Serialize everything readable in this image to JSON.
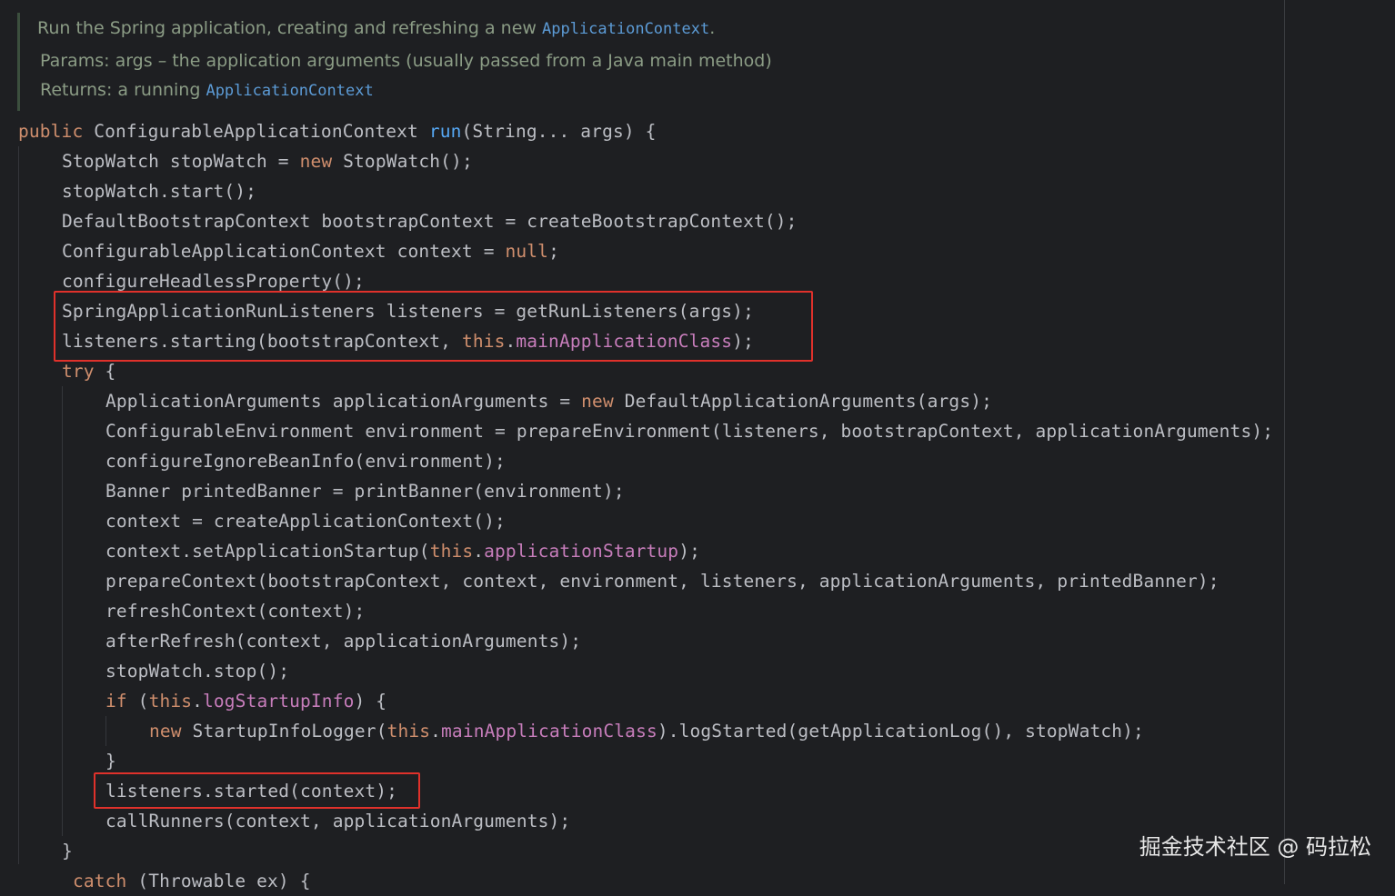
{
  "doc": {
    "summary_text": "Run the Spring application, creating and refreshing a new ",
    "summary_code": "ApplicationContext",
    "summary_end": ".",
    "params_label": "Params:",
    "params_name": "args",
    "params_desc": " – the application arguments (usually passed from a Java main method)",
    "returns_label": "Returns:",
    "returns_text": "a running ",
    "returns_code": "ApplicationContext"
  },
  "code": [
    [
      [
        "kw",
        "public"
      ],
      [
        "t",
        " ConfigurableApplicationContext "
      ],
      [
        "fn",
        "run"
      ],
      [
        "t",
        "(String... args) {"
      ]
    ],
    [
      [
        "t",
        "StopWatch stopWatch = "
      ],
      [
        "kw",
        "new"
      ],
      [
        "t",
        " StopWatch();"
      ]
    ],
    [
      [
        "t",
        "stopWatch.start();"
      ]
    ],
    [
      [
        "t",
        "DefaultBootstrapContext bootstrapContext = createBootstrapContext();"
      ]
    ],
    [
      [
        "t",
        "ConfigurableApplicationContext context = "
      ],
      [
        "kw",
        "null"
      ],
      [
        "t",
        ";"
      ]
    ],
    [
      [
        "t",
        "configureHeadlessProperty();"
      ]
    ],
    [
      [
        "t",
        "SpringApplicationRunListeners listeners = getRunListeners(args);"
      ]
    ],
    [
      [
        "t",
        "listeners.starting(bootstrapContext, "
      ],
      [
        "kw",
        "this"
      ],
      [
        "t",
        "."
      ],
      [
        "fld",
        "mainApplicationClass"
      ],
      [
        "t",
        ");"
      ]
    ],
    [
      [
        "kw",
        "try"
      ],
      [
        "t",
        " {"
      ]
    ],
    [
      [
        "t",
        "ApplicationArguments applicationArguments = "
      ],
      [
        "kw",
        "new"
      ],
      [
        "t",
        " DefaultApplicationArguments(args);"
      ]
    ],
    [
      [
        "t",
        "ConfigurableEnvironment environment = prepareEnvironment(listeners, bootstrapContext, applicationArguments);"
      ]
    ],
    [
      [
        "t",
        "configureIgnoreBeanInfo(environment);"
      ]
    ],
    [
      [
        "t",
        "Banner printedBanner = printBanner(environment);"
      ]
    ],
    [
      [
        "t",
        "context = createApplicationContext();"
      ]
    ],
    [
      [
        "t",
        "context.setApplicationStartup("
      ],
      [
        "kw",
        "this"
      ],
      [
        "t",
        "."
      ],
      [
        "fld",
        "applicationStartup"
      ],
      [
        "t",
        ");"
      ]
    ],
    [
      [
        "t",
        "prepareContext(bootstrapContext, context, environment, listeners, applicationArguments, printedBanner);"
      ]
    ],
    [
      [
        "t",
        "refreshContext(context);"
      ]
    ],
    [
      [
        "t",
        "afterRefresh(context, applicationArguments);"
      ]
    ],
    [
      [
        "t",
        "stopWatch.stop();"
      ]
    ],
    [
      [
        "kw",
        "if"
      ],
      [
        "t",
        " ("
      ],
      [
        "kw",
        "this"
      ],
      [
        "t",
        "."
      ],
      [
        "fld",
        "logStartupInfo"
      ],
      [
        "t",
        ") {"
      ]
    ],
    [
      [
        "kw",
        "new"
      ],
      [
        "t",
        " StartupInfoLogger("
      ],
      [
        "kw",
        "this"
      ],
      [
        "t",
        "."
      ],
      [
        "fld",
        "mainApplicationClass"
      ],
      [
        "t",
        ").logStarted(getApplicationLog(), stopWatch);"
      ]
    ],
    [
      [
        "t",
        "}"
      ]
    ],
    [
      [
        "t",
        "listeners.started(context);"
      ]
    ],
    [
      [
        "t",
        "callRunners(context, applicationArguments);"
      ]
    ],
    [
      [
        "t",
        "}"
      ]
    ],
    [
      [
        "kw",
        "catch"
      ],
      [
        "t",
        " (Throwable ex) {"
      ]
    ]
  ],
  "watermark": "掘金技术社区 @ 码拉松",
  "colors": {
    "background": "#1e1f22",
    "text": "#bcbec4",
    "keyword": "#cf8e6d",
    "function": "#56a8f5",
    "field": "#c77dbb",
    "doc": "#8b9c85",
    "highlight_box": "#e0312b"
  }
}
